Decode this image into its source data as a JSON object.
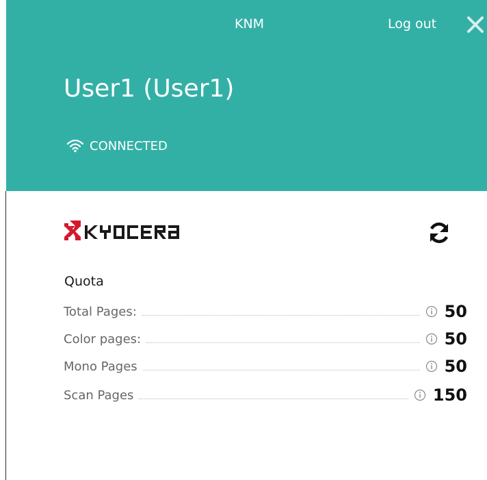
{
  "header": {
    "app_name": "KNM",
    "logout_label": "Log out",
    "user_display": "User1 (User1)",
    "status_text": "CONNECTED",
    "accent_color": "#33b0a6"
  },
  "brand": {
    "logo_text": "KYOCERA",
    "logo_color": "#d3192d"
  },
  "quota": {
    "title": "Quota",
    "rows": [
      {
        "label": "Total Pages:",
        "value": "50"
      },
      {
        "label": "Color pages:",
        "value": "50"
      },
      {
        "label": "Mono Pages",
        "value": "50"
      },
      {
        "label": "Scan Pages",
        "value": "150"
      }
    ]
  },
  "icons": {
    "status": "wifi-icon",
    "close": "close-icon",
    "refresh": "refresh-icon",
    "info": "info-icon"
  }
}
